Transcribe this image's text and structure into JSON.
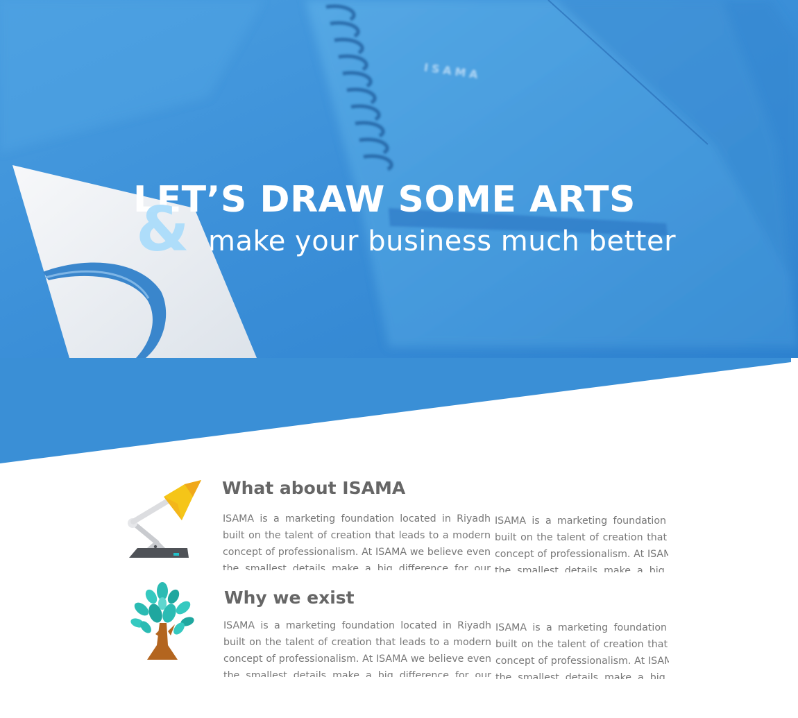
{
  "colors": {
    "hero_blue": "#3a8fd6",
    "hero_blue_dark": "#2f80cc",
    "headline": "#ffffff",
    "ampersand": "#a9dcfb",
    "title_text": "#666666",
    "body_text": "#777777",
    "lamp_yellow": "#f5c518",
    "tree_teal": "#2bbbb3",
    "tree_trunk": "#b3651f"
  },
  "hero": {
    "headline": "LET’S DRAW SOME ARTS",
    "ampersand": "&",
    "subline": "make your business much better",
    "notebook_label": "ISAMA"
  },
  "features": [
    {
      "icon": "desk-lamp-icon",
      "title": "What about ISAMA",
      "column_1": "ISAMA is a marketing foundation located in Riyadh built on the talent of creation that leads to a modern concept of professionalism. At ISAMA we believe even the smallest details make a big difference for our clients.",
      "column_2": "ISAMA is a marketing foundation located in Riyadh built on the talent of creation that leads to a modern concept of professionalism. At ISAMA we believe even the smallest details make a big difference for our clients."
    },
    {
      "icon": "tree-icon",
      "title": "Why we exist",
      "column_1": "ISAMA is a marketing foundation located in Riyadh built on the talent of creation that leads to a modern concept of professionalism. At ISAMA we believe even the smallest details make a big difference for our clients.",
      "column_2": "ISAMA is a marketing foundation located in Riyadh built on the talent of creation that leads to a modern concept of professionalism. At ISAMA we believe even the smallest details make a big difference for our clients."
    }
  ]
}
